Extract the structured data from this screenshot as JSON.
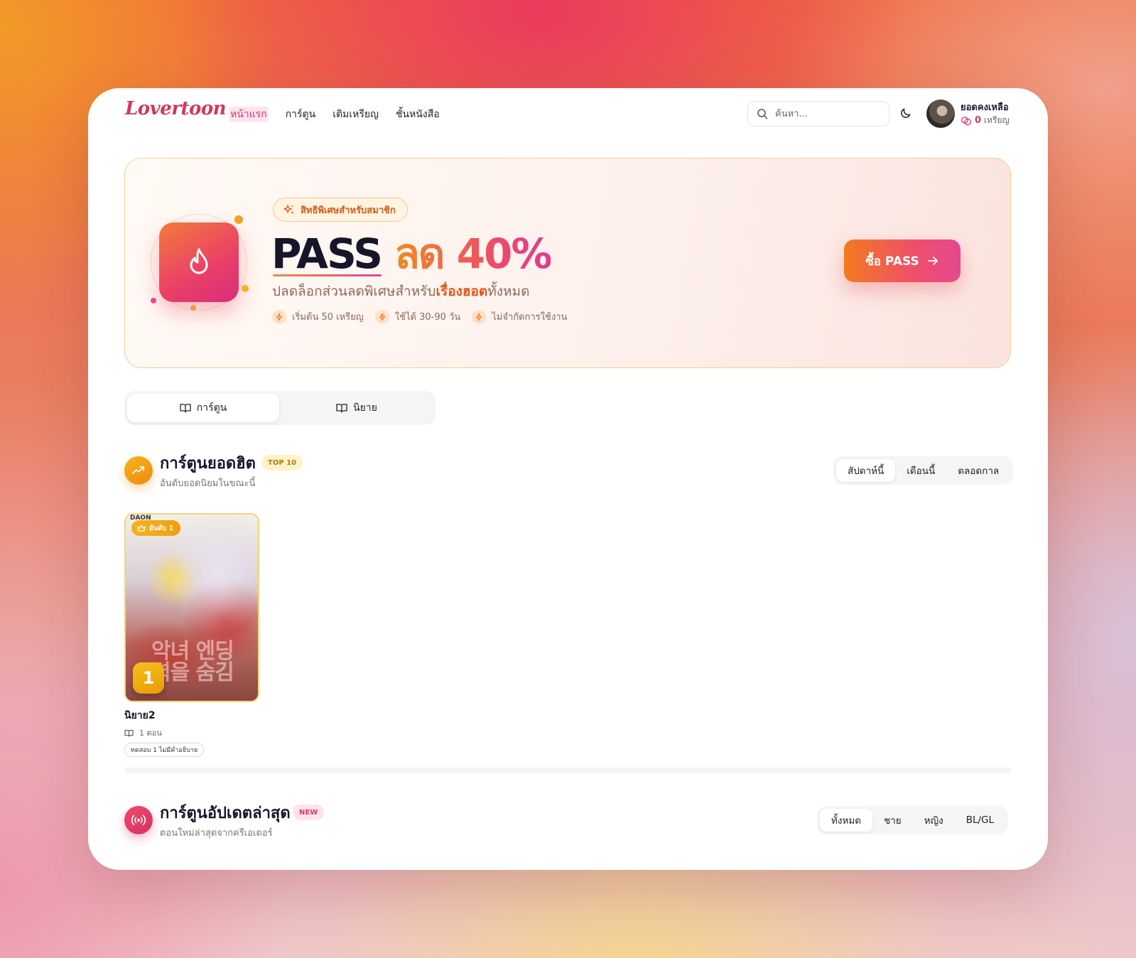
{
  "colors": {
    "brand": "#e0326c",
    "accent_orange": "#f37a1e",
    "gold": "#f6b31a"
  },
  "header": {
    "logo": "Lovertoon",
    "nav": [
      "หน้าแรก",
      "การ์ตูน",
      "เติมเหรียญ",
      "ชั้นหนังสือ"
    ],
    "search_placeholder": "ค้นหา...",
    "user_label": "ยอดคงเหลือ",
    "coin_amount": "0",
    "coin_unit": "เหรียญ"
  },
  "banner": {
    "member_label": "สิทธิพิเศษสำหรับสมาชิก",
    "headline_pass": "PASS",
    "headline_off": "ลด 40%",
    "sub_prefix": "ปลดล็อกส่วนลดพิเศษสำหรับ",
    "sub_highlight": "เรื่องฮอต",
    "sub_suffix": "ทั้งหมด",
    "features": [
      "เริ่มต้น 50 เหรียญ",
      "ใช้ได้ 30-90 วัน",
      "ไม่จำกัดการใช้งาน"
    ],
    "buy_label": "ซื้อ PASS"
  },
  "type_tabs": [
    "การ์ตูน",
    "นิยาย"
  ],
  "top_section": {
    "title": "การ์ตูนยอดฮิต",
    "badge": "TOP 10",
    "subtitle": "อันดับยอดนิยมในขณะนี้",
    "filters": [
      "สัปดาห์นี้",
      "เดือนนี้",
      "ตลอดกาล"
    ]
  },
  "top_card": {
    "publisher": "DAON",
    "rank_label": "อันดับ 1",
    "cover_text": "악녀 엔딩\n력을 숨김",
    "rank_number": "1",
    "title": "นิยาย2",
    "episodes": "1 ตอน",
    "tag": "ทดสอบ 1 ไม่มีคำอธิบาย"
  },
  "latest_section": {
    "title": "การ์ตูนอัปเดตล่าสุด",
    "badge": "NEW",
    "subtitle": "ตอนใหม่ล่าสุดจากครีเอเตอร์",
    "filters": [
      "ทั้งหมด",
      "ชาย",
      "หญิง",
      "BL/GL"
    ]
  }
}
